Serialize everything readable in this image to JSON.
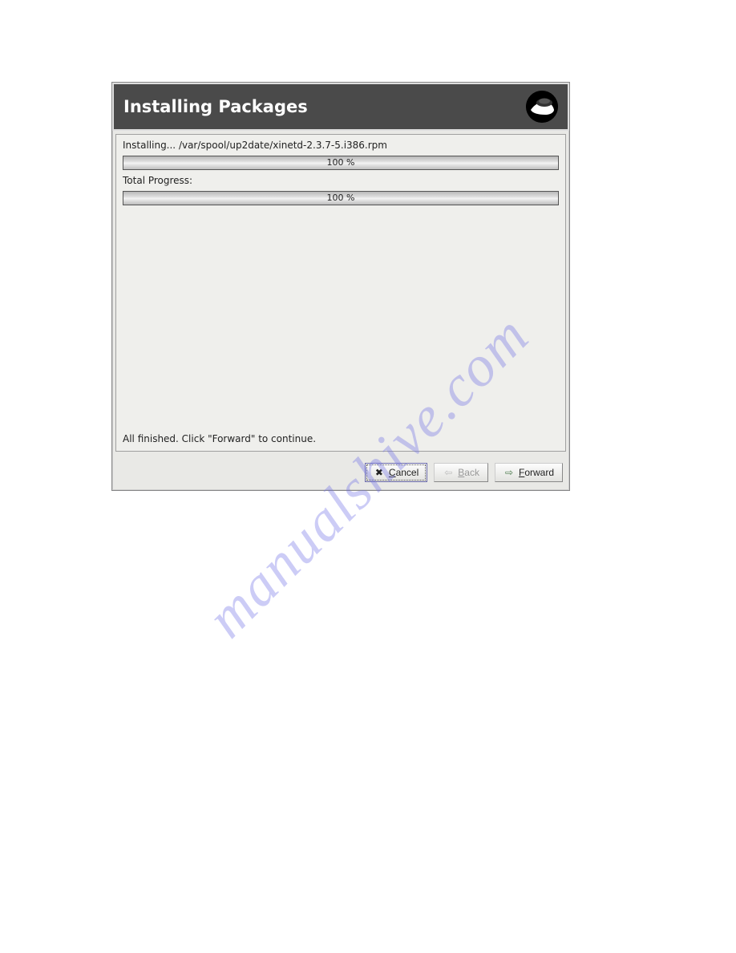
{
  "watermark": "manualshive.com",
  "dialog": {
    "title": "Installing Packages",
    "install_line": "Installing... /var/spool/up2date/xinetd-2.3.7-5.i386.rpm",
    "progress1_text": "100 %",
    "total_label": "Total Progress:",
    "progress2_text": "100 %",
    "finished_line": "All finished.  Click \"Forward\" to continue."
  },
  "buttons": {
    "cancel": "Cancel",
    "back": "Back",
    "forward": "Forward"
  }
}
